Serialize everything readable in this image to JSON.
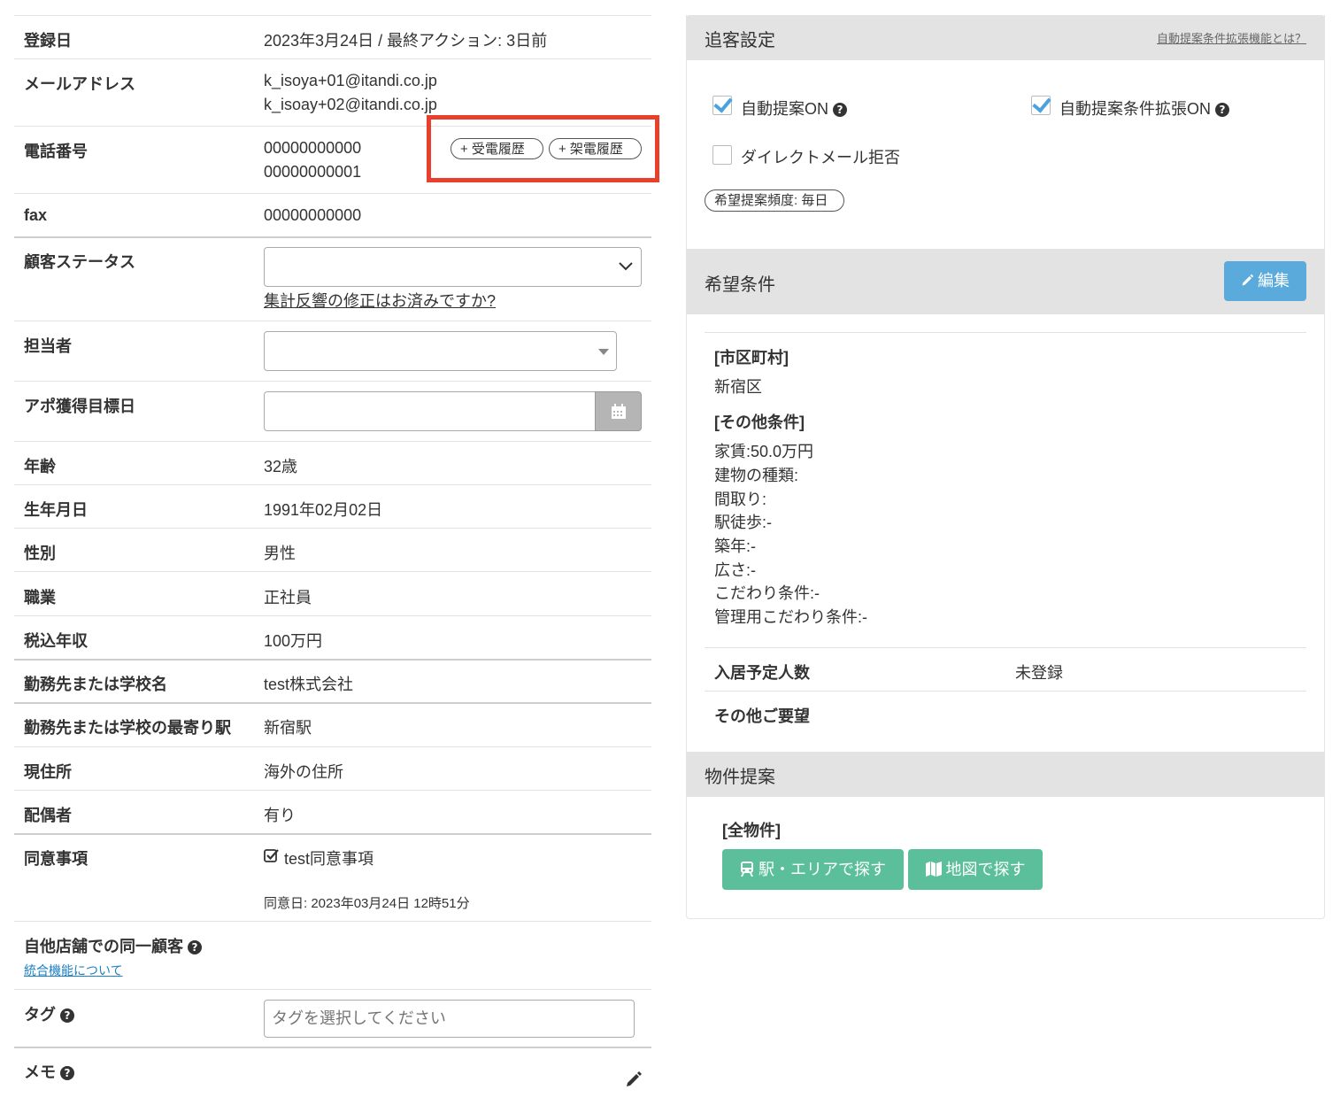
{
  "info": {
    "registered_label": "登録日",
    "registered_value": "2023年3月24日 / 最終アクション: 3日前",
    "email_label": "メールアドレス",
    "emails": [
      "k_isoya+01@itandi.co.jp",
      "k_isoay+02@itandi.co.jp"
    ],
    "phone_label": "電話番号",
    "phones": [
      "00000000000",
      "00000000001"
    ],
    "incoming_btn": "+ 受電履歴",
    "outgoing_btn": "+ 架電履歴",
    "fax_label": "fax",
    "fax_value": "00000000000",
    "status_label": "顧客ステータス",
    "status_link": "集計反響の修正はお済みですか?",
    "staff_label": "担当者",
    "appo_label": "アポ獲得目標日",
    "age_label": "年齢",
    "age_value": "32歳",
    "birth_label": "生年月日",
    "birth_value": "1991年02月02日",
    "gender_label": "性別",
    "gender_value": "男性",
    "job_label": "職業",
    "job_value": "正社員",
    "income_label": "税込年収",
    "income_value": "100万円",
    "work_label": "勤務先または学校名",
    "work_value": "test株式会社",
    "station_label": "勤務先または学校の最寄り駅",
    "station_value": "新宿駅",
    "address_label": "現住所",
    "address_value": "海外の住所",
    "spouse_label": "配偶者",
    "spouse_value": "有り",
    "consent_label": "同意事項",
    "consent_value": "test同意事項",
    "consent_date": "同意日: 2023年03月24日 12時51分",
    "same_customer_label": "自他店舗での同一顧客",
    "merge_link": "統合機能について",
    "tag_label": "タグ",
    "tag_placeholder": "タグを選択してください",
    "memo_label": "メモ"
  },
  "tracking": {
    "title": "追客設定",
    "help_link": "自動提案条件拡張機能とは？",
    "auto_propose": "自動提案ON",
    "auto_expand": "自動提案条件拡張ON",
    "dm_reject": "ダイレクトメール拒否",
    "frequency": "希望提案頻度: 毎日"
  },
  "preferences": {
    "title": "希望条件",
    "edit_btn": "編集",
    "city_heading": "[市区町村]",
    "city_value": "新宿区",
    "other_heading": "[その他条件]",
    "conditions": [
      "家賃:50.0万円",
      "建物の種類:",
      "間取り:",
      "駅徒歩:-",
      "築年:-",
      "広さ:-",
      "こだわり条件:-",
      "管理用こだわり条件:-"
    ],
    "residents_label": "入居予定人数",
    "residents_value": "未登録",
    "other_requests_label": "その他ご要望"
  },
  "proposal": {
    "title": "物件提案",
    "heading": "[全物件]",
    "station_btn": "駅・エリアで探す",
    "map_btn": "地図で探す"
  },
  "colors": {
    "highlight": "#e8402a",
    "edit_button": "#5aabdb",
    "green_button": "#5cbf9b",
    "checkbox": "#4aa3df"
  }
}
